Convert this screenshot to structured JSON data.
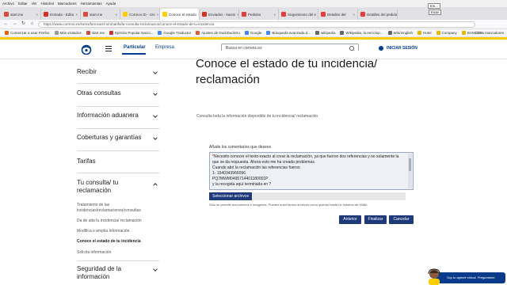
{
  "browser": {
    "menu": [
      "Archivo",
      "Editar",
      "Ver",
      "Historial",
      "Marcadores",
      "Herramientas",
      "Ayuda"
    ],
    "tabs": [
      {
        "label": "start.me",
        "color": "#d84b3a",
        "active": false
      },
      {
        "label": "Entrada - Edita",
        "color": "#d93025",
        "active": false
      },
      {
        "label": "start.me",
        "color": "#d84b3a",
        "active": false
      },
      {
        "label": "Correos ID - Uni",
        "color": "#ffcd00",
        "active": false
      },
      {
        "label": "Conoce el estado",
        "color": "#ffcd00",
        "active": true
      },
      {
        "label": "Enviados - kasmi",
        "color": "#d93025",
        "active": false
      },
      {
        "label": "Pedidos",
        "color": "#e63e3e",
        "active": false
      },
      {
        "label": "Seguimiento del e",
        "color": "#e63e3e",
        "active": false
      },
      {
        "label": "Detalles del",
        "color": "#e63e3e",
        "active": false
      },
      {
        "label": "Detalles del pedido",
        "color": "#e63e3e",
        "active": false
      }
    ],
    "tooltip_1": "Ins...",
    "tooltip_2": "Incar",
    "url": "https://www.correos.es/es/es/ferrocarril-al-sharifa/la-consulta-reclamacion/conoce-el-estado-de-tu-incidencia",
    "bookmarks": [
      "Comenzar a usar Firefox",
      "Más visitados",
      "start.me",
      "Ejército Popular Nacio...",
      "Google Traductor",
      "Ajustes de DuckDuckGo",
      "Google",
      "Búsqueda avanzada d...",
      "wikipedia",
      "Wikipedia, la enciclop...",
      "Wiki English",
      "Hotel",
      "Company",
      "BANCOS"
    ],
    "bookmarks_right": "Otros marcadores"
  },
  "header": {
    "nav_particular": "Particular",
    "nav_empresa": "Empresa",
    "search_placeholder": "Busca en correos.es",
    "login_label": "INICIAR SESIÓN"
  },
  "sidebar": {
    "sections": [
      "Recibir",
      "Otras consultas",
      "Información aduanera",
      "Coberturas y garantías",
      "Tarifas",
      "Tu consulta/ tu reclamación",
      "Seguridad de la información"
    ],
    "sublinks": [
      "Tratamiento de las incidencias/reclamaciones/consultas",
      "Da de alta tu incidencia/ reclamación",
      "Modifica o amplía información",
      "Conoce el estado de tu incidencia",
      "Solicita información"
    ]
  },
  "main": {
    "title_line1": "Conoce el estado de tu incidencia/",
    "title_line2": "reclamación",
    "intro": "Consulta toda la información disponible de tu incidencia/ reclamación",
    "comment_label": "Añade los comentarios que desees",
    "comment_lines": [
      "Necesito conocer el texto exacto al crear la reclamación, ya que fueron dos referencias y no solamente la",
      "que se da respuesta. Ahora esto me ha creado problemas.",
      "Cuando abrí la reclamación las referencias fueron",
      "1- 1540343966096",
      "PQ7MWM0495714401180001P",
      "y la recogida aquí terminada en ?"
    ],
    "file_button": "Seleccionar archivos",
    "file_hint": "Sólo se permite documentos e imágenes. Puedes subir tantos archivos como quieras hasta un máximo de 50Mb",
    "buttons": {
      "back": "Anterior",
      "finish": "Finalizar",
      "cancel": "Cancelar"
    }
  },
  "chat": {
    "label": "Soy tu agente virtual. Pregúntame."
  },
  "colors": {
    "brand_yellow": "#ffcd00",
    "brand_blue": "#003d8f",
    "button_blue": "#1e3a78"
  }
}
